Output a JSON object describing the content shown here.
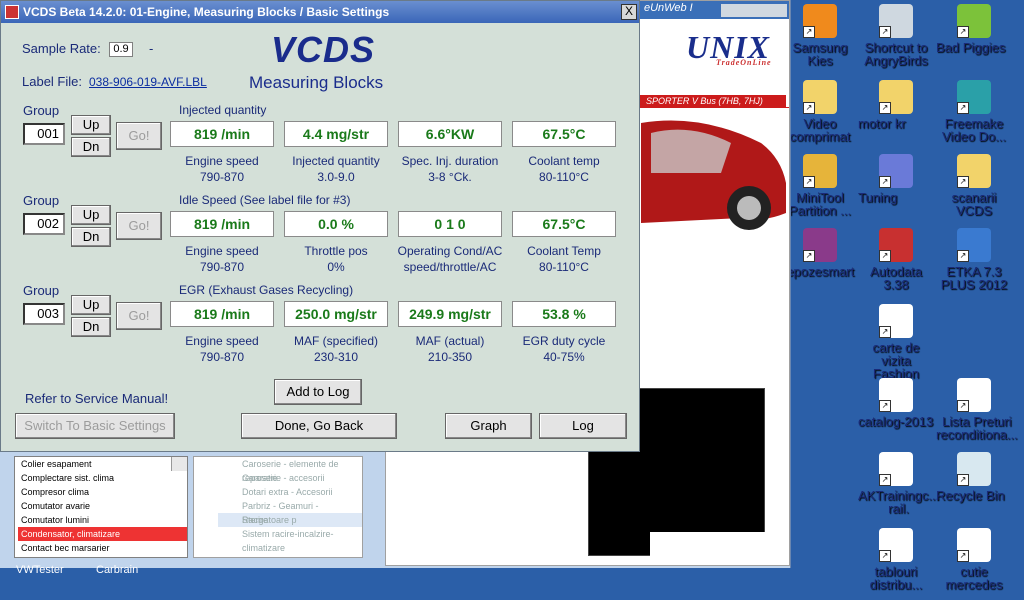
{
  "window": {
    "title": "VCDS Beta 14.2.0: 01-Engine,  Measuring Blocks / Basic Settings",
    "close": "X",
    "sample_rate_label": "Sample Rate:",
    "sample_rate_value": "0.9",
    "sample_rate_dash": "-",
    "label_file_label": "Label File:",
    "label_file_link": "038-906-019-AVF.LBL",
    "logo": "VCDS",
    "subtitle": "Measuring Blocks",
    "refer_text": "Refer to Service Manual!",
    "buttons": {
      "switch_basic": "Switch To Basic Settings",
      "add_to_log": "Add to Log",
      "done": "Done, Go Back",
      "graph": "Graph",
      "log": "Log"
    }
  },
  "groups": [
    {
      "label": "Group",
      "number": "001",
      "up": "Up",
      "dn": "Dn",
      "go": "Go!",
      "title": "Injected quantity",
      "values": [
        "819 /min",
        "4.4 mg/str",
        "6.6°KW",
        "67.5°C"
      ],
      "captions": [
        [
          "Engine speed",
          "790-870"
        ],
        [
          "Injected quantity",
          "3.0-9.0"
        ],
        [
          "Spec. Inj. duration",
          "3-8 °Ck."
        ],
        [
          "Coolant temp",
          "80-110°C"
        ]
      ]
    },
    {
      "label": "Group",
      "number": "002",
      "up": "Up",
      "dn": "Dn",
      "go": "Go!",
      "title": "Idle Speed (See label file for #3)",
      "values": [
        "819 /min",
        "0.0 %",
        "0  1  0",
        "67.5°C"
      ],
      "captions": [
        [
          "Engine speed",
          "790-870"
        ],
        [
          "Throttle pos",
          "0%"
        ],
        [
          "Operating Cond/AC",
          "speed/throttle/AC"
        ],
        [
          "Coolant Temp",
          "80-110°C"
        ]
      ]
    },
    {
      "label": "Group",
      "number": "003",
      "up": "Up",
      "dn": "Dn",
      "go": "Go!",
      "title": "EGR (Exhaust Gases Recycling)",
      "values": [
        "819 /min",
        "250.0 mg/str",
        "249.9 mg/str",
        "53.8 %"
      ],
      "captions": [
        [
          "Engine speed",
          "790-870"
        ],
        [
          "MAF (specified)",
          "230-310"
        ],
        [
          "MAF (actual)",
          "210-350"
        ],
        [
          "EGR duty cycle",
          "40-75%"
        ]
      ]
    }
  ],
  "background_app": {
    "web_tab_text": "eUnWeb I",
    "brand": "UNIX",
    "brand_sub": "TradeOnLine",
    "red_banner": "SPORTER V Bus (7HB, 7HJ)",
    "list1": [
      "Colier esapament",
      "Complectare sist. clima",
      "Compresor clima",
      "Comutator avarie",
      "Comutator lumini",
      "Condensator, climatizare",
      "Contact bec marsarier"
    ],
    "list1_selected": 5,
    "list2": [
      "Caroserie - elemente de reparatie",
      "Caroserie - accesorii",
      "Dotari extra - Accesorii",
      "Parbriz - Geamuri - Stergatoare p",
      "Racire",
      "Sistem racire-incalzire-climatizare"
    ],
    "list2_highlight": 4
  },
  "taskbar_labels": [
    "VWTester",
    "Carbrain"
  ],
  "desktop_icons": [
    {
      "label": "Samsung Kies",
      "icon": "samsung-kies-icon",
      "color": "#f08a1c"
    },
    {
      "label": "Shortcut to AngryBirds",
      "icon": "angry-birds-icon",
      "color": "#cfd8e0"
    },
    {
      "label": "Bad Piggies",
      "icon": "bad-piggies-icon",
      "color": "#7cc23a"
    },
    {
      "label": "Video comprimat",
      "icon": "folder-icon",
      "color": "#f2d36a"
    },
    {
      "label": "motor kr",
      "icon": "folder-icon",
      "color": "#f2d36a"
    },
    {
      "label": "Freemake Video Do...",
      "icon": "freemake-icon",
      "color": "#2aa0a8"
    },
    {
      "label": "MiniTool Partition ...",
      "icon": "minitool-icon",
      "color": "#e6b43a"
    },
    {
      "label": "Tuning",
      "icon": "gear-icon",
      "color": "#6a7ad8"
    },
    {
      "label": "scanarii VCDS",
      "icon": "folder-icon",
      "color": "#f2d36a"
    },
    {
      "label": "repozesmart",
      "icon": "winrar-icon",
      "color": "#8a3a8a"
    },
    {
      "label": "Autodata 3.38",
      "icon": "autodata-icon",
      "color": "#c83030"
    },
    {
      "label": "ETKA 7.3 PLUS 2012",
      "icon": "globe-icon",
      "color": "#3a7ad0"
    },
    {
      "label": "carte de vizita Fashion Story",
      "icon": "word-doc-icon",
      "color": "#ffffff"
    },
    {
      "label": "catalog-2013",
      "icon": "pdf-icon",
      "color": "#ffffff"
    },
    {
      "label": "Lista Preturi reconditiona...",
      "icon": "pdf-icon",
      "color": "#ffffff"
    },
    {
      "label": "AKTrainingc... rail.",
      "icon": "pdf-icon",
      "color": "#ffffff"
    },
    {
      "label": "Recycle Bin",
      "icon": "recycle-bin-icon",
      "color": "#d8e8f0"
    },
    {
      "label": "tablouri distribu...",
      "icon": "excel-icon",
      "color": "#ffffff"
    },
    {
      "label": "cutie mercedes",
      "icon": "word-doc-icon",
      "color": "#ffffff"
    }
  ]
}
